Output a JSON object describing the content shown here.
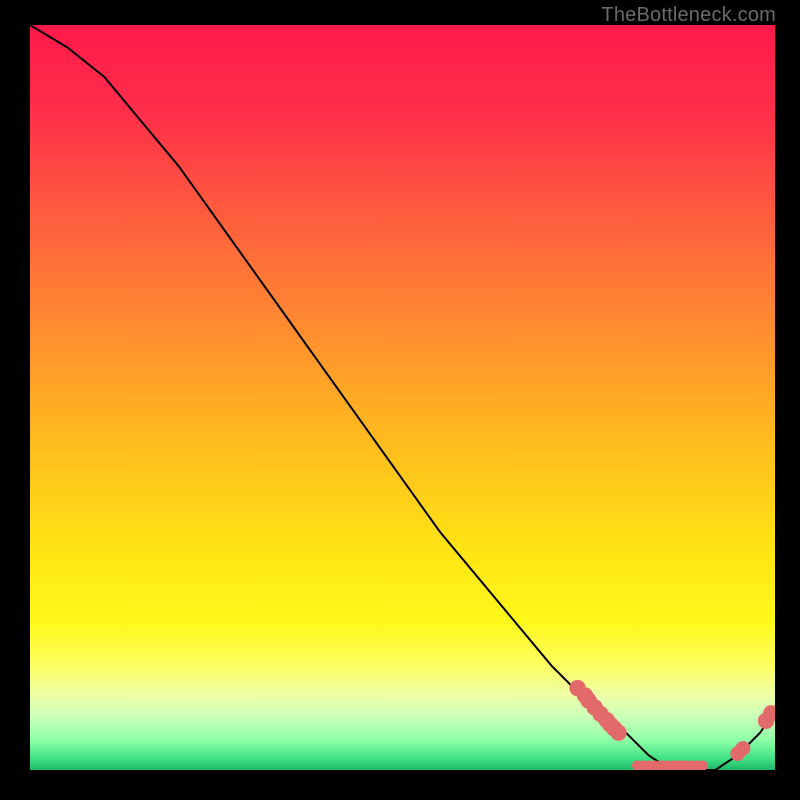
{
  "watermark": "TheBottleneck.com",
  "chart_data": {
    "type": "line",
    "title": "",
    "xlabel": "",
    "ylabel": "",
    "xlim": [
      0,
      100
    ],
    "ylim": [
      0,
      100
    ],
    "curve": {
      "name": "bottleneck-curve",
      "x": [
        0,
        5,
        10,
        15,
        20,
        25,
        30,
        35,
        40,
        45,
        50,
        55,
        60,
        65,
        70,
        75,
        80,
        83,
        86,
        89,
        92,
        95,
        98,
        100
      ],
      "y": [
        100,
        97,
        93,
        87,
        81,
        74,
        67,
        60,
        53,
        46,
        39,
        32,
        26,
        20,
        14,
        9,
        5,
        2,
        0,
        0,
        0,
        2,
        5,
        8
      ]
    },
    "markers": {
      "name": "highlight-dots",
      "color": "#e26a6a",
      "points": [
        {
          "x": 73.5,
          "y": 11.0,
          "r": 1.1
        },
        {
          "x": 74.5,
          "y": 10.0,
          "r": 1.1
        },
        {
          "x": 75.0,
          "y": 9.3,
          "r": 1.1
        },
        {
          "x": 75.8,
          "y": 8.4,
          "r": 1.1
        },
        {
          "x": 76.6,
          "y": 7.5,
          "r": 1.1
        },
        {
          "x": 77.4,
          "y": 6.7,
          "r": 1.1
        },
        {
          "x": 77.9,
          "y": 6.1,
          "r": 1.1
        },
        {
          "x": 78.4,
          "y": 5.6,
          "r": 1.1
        },
        {
          "x": 79.0,
          "y": 5.0,
          "r": 1.1
        },
        {
          "x": 81.5,
          "y": 0.6,
          "r": 0.7
        },
        {
          "x": 82.3,
          "y": 0.6,
          "r": 0.7
        },
        {
          "x": 83.1,
          "y": 0.6,
          "r": 0.7
        },
        {
          "x": 83.9,
          "y": 0.6,
          "r": 0.7
        },
        {
          "x": 84.7,
          "y": 0.6,
          "r": 0.7
        },
        {
          "x": 85.5,
          "y": 0.6,
          "r": 0.7
        },
        {
          "x": 86.3,
          "y": 0.6,
          "r": 0.7
        },
        {
          "x": 87.1,
          "y": 0.6,
          "r": 0.7
        },
        {
          "x": 87.9,
          "y": 0.6,
          "r": 0.7
        },
        {
          "x": 88.7,
          "y": 0.6,
          "r": 0.7
        },
        {
          "x": 89.5,
          "y": 0.6,
          "r": 0.7
        },
        {
          "x": 90.3,
          "y": 0.6,
          "r": 0.7
        },
        {
          "x": 95.0,
          "y": 2.2,
          "r": 1.0
        },
        {
          "x": 95.7,
          "y": 2.9,
          "r": 1.0
        },
        {
          "x": 98.8,
          "y": 6.6,
          "r": 1.1
        },
        {
          "x": 99.5,
          "y": 7.6,
          "r": 1.1
        }
      ]
    },
    "gradient_stops": [
      {
        "offset": 0.0,
        "color": "#ff1a4b"
      },
      {
        "offset": 0.12,
        "color": "#ff2f49"
      },
      {
        "offset": 0.25,
        "color": "#ff5b3f"
      },
      {
        "offset": 0.4,
        "color": "#ff8a30"
      },
      {
        "offset": 0.55,
        "color": "#ffb91f"
      },
      {
        "offset": 0.7,
        "color": "#ffe313"
      },
      {
        "offset": 0.8,
        "color": "#fff81a"
      },
      {
        "offset": 0.86,
        "color": "#fdff60"
      },
      {
        "offset": 0.9,
        "color": "#eeffa8"
      },
      {
        "offset": 0.93,
        "color": "#c9ffb9"
      },
      {
        "offset": 0.96,
        "color": "#8effa6"
      },
      {
        "offset": 0.985,
        "color": "#3fe084"
      },
      {
        "offset": 1.0,
        "color": "#1fb86a"
      }
    ]
  }
}
